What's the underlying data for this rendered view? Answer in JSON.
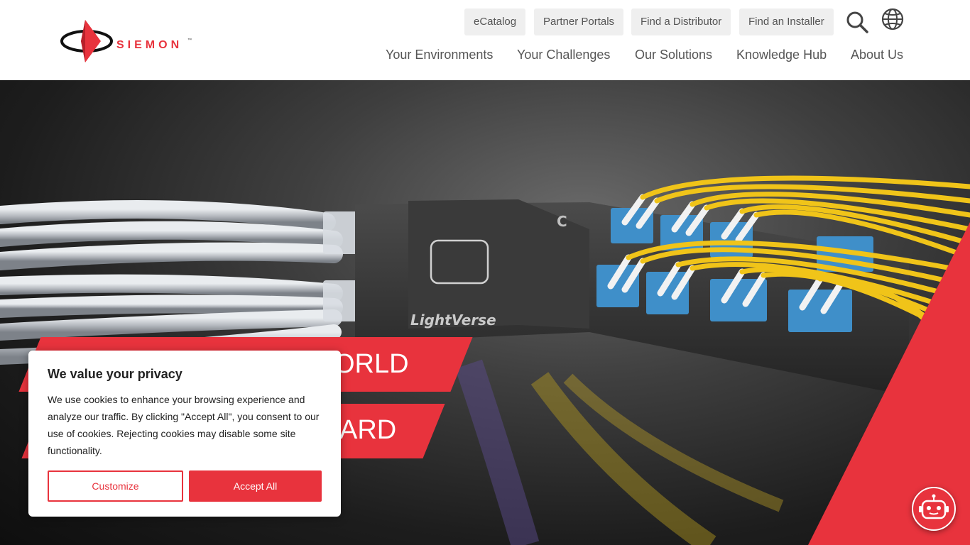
{
  "brand": {
    "name": "SIEMON",
    "trademark": "™",
    "accent_color": "#e8333d"
  },
  "utility_nav": [
    {
      "label": "eCatalog"
    },
    {
      "label": "Partner Portals"
    },
    {
      "label": "Find a Distributor"
    },
    {
      "label": "Find an Installer"
    }
  ],
  "main_nav": [
    {
      "label": "Your Environments"
    },
    {
      "label": "Your Challenges"
    },
    {
      "label": "Our Solutions"
    },
    {
      "label": "Knowledge Hub"
    },
    {
      "label": "About Us"
    }
  ],
  "icons": {
    "search": "search-icon",
    "language": "globe-icon",
    "chatbot": "robot-icon"
  },
  "hero": {
    "product_label": "LightVerse",
    "port_label": "C",
    "headline_line1_visible": "ORLD",
    "headline_line2_visible": "ARD"
  },
  "cookie_banner": {
    "title": "We value your privacy",
    "body": "We use cookies to enhance your browsing experience and analyze our traffic. By clicking \"Accept All\", you consent to our use of cookies. Rejecting cookies may disable some site functionality.",
    "customize_label": "Customize",
    "accept_label": "Accept All"
  }
}
